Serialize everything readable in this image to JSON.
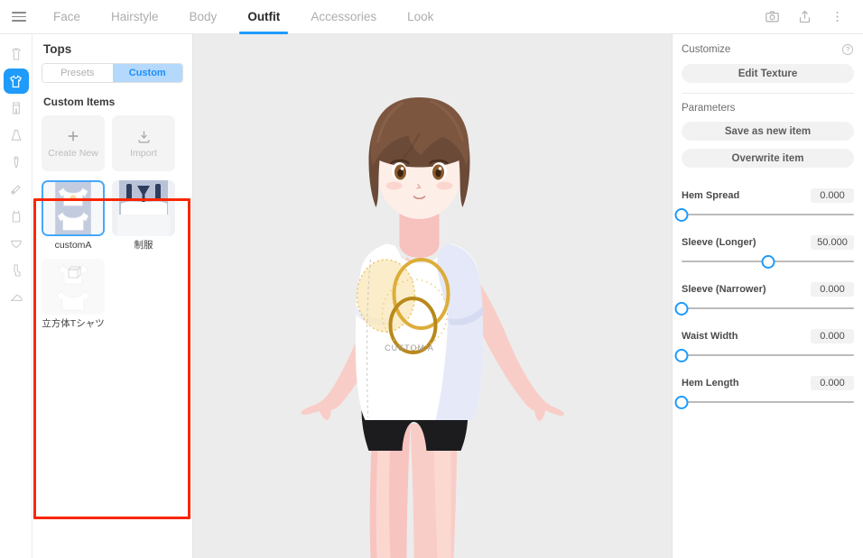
{
  "topbar": {
    "menu_icon": "hamburger-icon",
    "tabs": [
      {
        "label": "Face",
        "active": false
      },
      {
        "label": "Hairstyle",
        "active": false
      },
      {
        "label": "Body",
        "active": false
      },
      {
        "label": "Outfit",
        "active": true
      },
      {
        "label": "Accessories",
        "active": false
      },
      {
        "label": "Look",
        "active": false
      }
    ],
    "actions": [
      {
        "name": "camera-icon",
        "label": ""
      },
      {
        "name": "share-icon",
        "label": ""
      },
      {
        "name": "more-vertical-icon",
        "label": ""
      }
    ]
  },
  "rail": {
    "items": [
      {
        "name": "dress-icon",
        "active": false
      },
      {
        "name": "tshirt-icon",
        "active": true
      },
      {
        "name": "pants-icon",
        "active": false
      },
      {
        "name": "skirt-icon",
        "active": false
      },
      {
        "name": "necktie-icon",
        "active": false
      },
      {
        "name": "accessory-icon",
        "active": false
      },
      {
        "name": "tanktop-icon",
        "active": false
      },
      {
        "name": "underwear-icon",
        "active": false
      },
      {
        "name": "socks-icon",
        "active": false
      },
      {
        "name": "shoes-icon",
        "active": false
      }
    ]
  },
  "sidebar": {
    "title": "Tops",
    "segment": {
      "options": [
        {
          "label": "Presets",
          "active": false
        },
        {
          "label": "Custom",
          "active": true
        }
      ]
    },
    "custom_items_title": "Custom Items",
    "actions": [
      {
        "label": "Create New",
        "icon": "plus-icon"
      },
      {
        "label": "Import",
        "icon": "download-icon"
      }
    ],
    "items": [
      {
        "label": "customA",
        "selected": true,
        "faded": false
      },
      {
        "label": "制服",
        "selected": false,
        "faded": false
      },
      {
        "label": "立方体Tシャツ",
        "selected": false,
        "faded": true
      }
    ]
  },
  "viewport": {
    "shirt_print_text": "CUSTOM A",
    "background_color": "#ececec"
  },
  "inspector": {
    "customize_label": "Customize",
    "help_icon": "help-circle-icon",
    "edit_texture_label": "Edit Texture",
    "parameters_label": "Parameters",
    "save_as_new_label": "Save as new item",
    "overwrite_label": "Overwrite item",
    "sliders": [
      {
        "label": "Hem Spread",
        "value": "0.000",
        "percent": 0
      },
      {
        "label": "Sleeve (Longer)",
        "value": "50.000",
        "percent": 50
      },
      {
        "label": "Sleeve (Narrower)",
        "value": "0.000",
        "percent": 0
      },
      {
        "label": "Waist Width",
        "value": "0.000",
        "percent": 0
      },
      {
        "label": "Hem Length",
        "value": "0.000",
        "percent": 0
      }
    ]
  },
  "theme": {
    "accent": "#1e9bfb",
    "accent_soft": "#b4d9fd",
    "annotation": "#fa2600",
    "panel_bg": "#ffffff",
    "viewport_bg": "#ececec"
  }
}
